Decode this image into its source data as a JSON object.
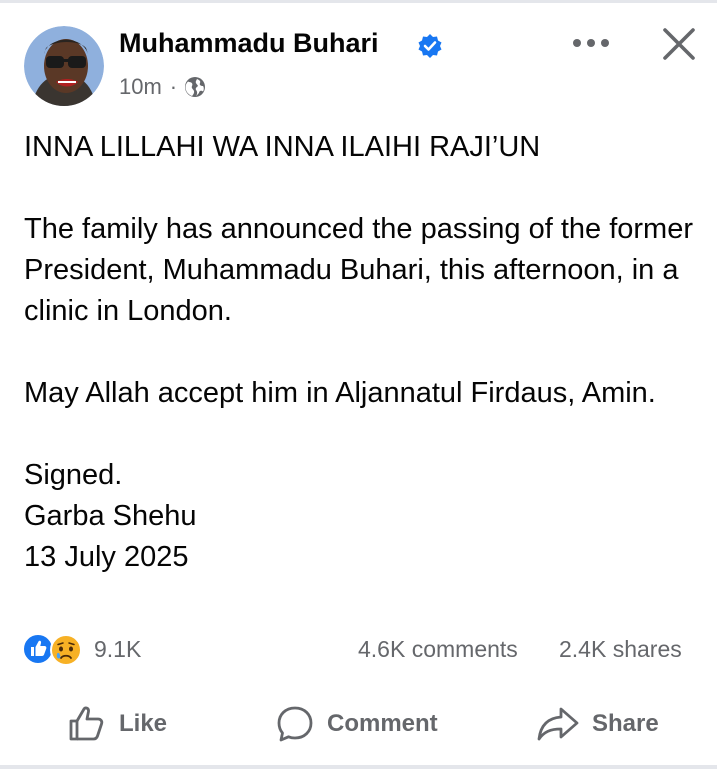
{
  "post": {
    "author": "Muhammadu Buhari",
    "verified_icon": "verified-badge-icon",
    "time": "10m",
    "separator": "·",
    "audience_icon": "globe-icon",
    "text": "INNA LILLAHI WA INNA ILAIHI RAJI’UN\n\nThe family has announced the passing of the former President, Muhammadu Buhari, this afternoon, in a clinic in London.\n\nMay Allah accept him in Aljannatul Firdaus, Amin.\n\nSigned.\nGarba Shehu\n13 July 2025"
  },
  "stats": {
    "reactions_count": "9.1K",
    "reaction_icons": [
      "like-reaction-icon",
      "sad-reaction-icon"
    ],
    "comments": "4.6K comments",
    "shares": "2.4K shares"
  },
  "actions": {
    "like": "Like",
    "comment": "Comment",
    "share": "Share"
  },
  "colors": {
    "text": "#050505",
    "secondary": "#65676b",
    "facebook_blue": "#1877f2",
    "sad_yellow": "#f7b125"
  }
}
